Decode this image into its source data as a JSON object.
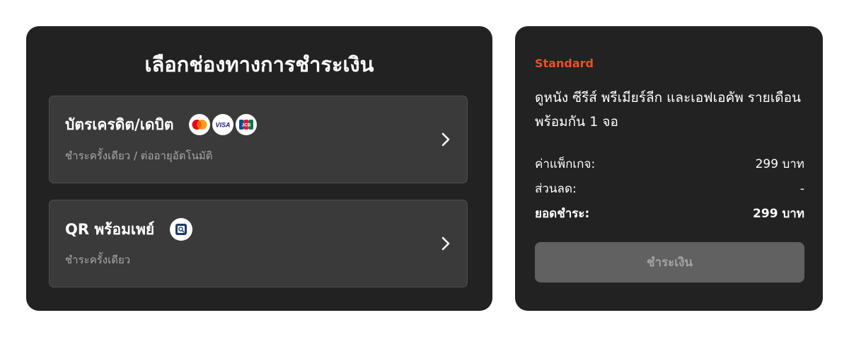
{
  "payment_methods": {
    "title": "เลือกช่องทางการชำระเงิน",
    "options": [
      {
        "label": "บัตรเครดิต/เดบิต",
        "subtitle": "ชำระครั้งเดียว / ต่ออายุอัตโนมัติ",
        "icons": [
          "mastercard-icon",
          "visa-icon",
          "jcb-icon"
        ],
        "visa_text": "VISA",
        "jcb_text": "JCB"
      },
      {
        "label": "QR พร้อมเพย์",
        "subtitle": "ชำระครั้งเดียว",
        "icons": [
          "qr-scan-icon"
        ]
      }
    ]
  },
  "summary": {
    "plan_name": "Standard",
    "plan_description": "ดูหนัง ซีรีส์ พรีเมียร์ลีก และเอฟเอคัพ รายเดือน พร้อมกัน 1 จอ",
    "package_label": "ค่าแพ็กเกจ:",
    "package_value": "299 บาท",
    "discount_label": "ส่วนลด:",
    "discount_value": "-",
    "total_label": "ยอดชำระ:",
    "total_value": "299 บาท",
    "pay_button": "ชำระเงิน"
  },
  "colors": {
    "panel_bg": "#222222",
    "card_bg": "#3a3a3a",
    "accent": "#f04e23",
    "button_disabled": "#616161"
  }
}
